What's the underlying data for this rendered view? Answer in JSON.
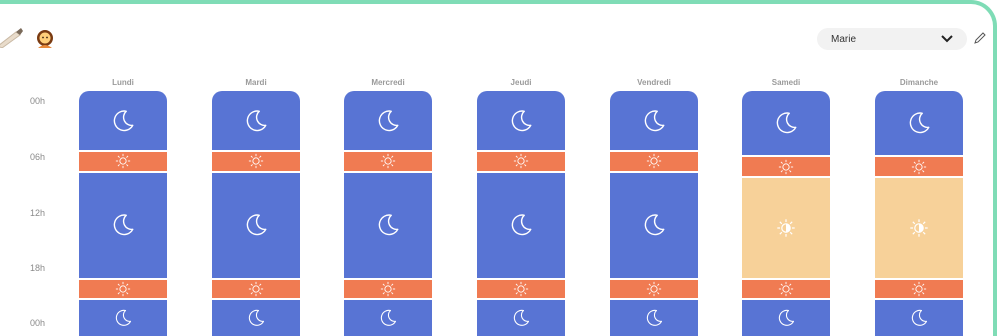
{
  "header": {
    "user_select_value": "Marie",
    "icons": {
      "brush": "brush-icon",
      "avatar": "person-avatar-icon",
      "dropdown": "chevron-down-icon",
      "edit": "pencil-icon"
    }
  },
  "hours": [
    "00h",
    "06h",
    "12h",
    "18h",
    "00h"
  ],
  "colors": {
    "night": "#5874d4",
    "day": "#f07b52",
    "light": "#f7d199",
    "accent": "#7fdcb6"
  },
  "days": [
    {
      "name": "Lundi",
      "segments": [
        {
          "type": "night",
          "from": 0,
          "to": 6
        },
        {
          "type": "day",
          "from": 6,
          "to": 8
        },
        {
          "type": "night",
          "from": 8,
          "to": 18.5
        },
        {
          "type": "day",
          "from": 18.5,
          "to": 20.5
        },
        {
          "type": "night",
          "from": 20.5,
          "to": 24
        }
      ]
    },
    {
      "name": "Mardi",
      "segments": [
        {
          "type": "night",
          "from": 0,
          "to": 6
        },
        {
          "type": "day",
          "from": 6,
          "to": 8
        },
        {
          "type": "night",
          "from": 8,
          "to": 18.5
        },
        {
          "type": "day",
          "from": 18.5,
          "to": 20.5
        },
        {
          "type": "night",
          "from": 20.5,
          "to": 24
        }
      ]
    },
    {
      "name": "Mercredi",
      "segments": [
        {
          "type": "night",
          "from": 0,
          "to": 6
        },
        {
          "type": "day",
          "from": 6,
          "to": 8
        },
        {
          "type": "night",
          "from": 8,
          "to": 18.5
        },
        {
          "type": "day",
          "from": 18.5,
          "to": 20.5
        },
        {
          "type": "night",
          "from": 20.5,
          "to": 24
        }
      ]
    },
    {
      "name": "Jeudi",
      "segments": [
        {
          "type": "night",
          "from": 0,
          "to": 6
        },
        {
          "type": "day",
          "from": 6,
          "to": 8
        },
        {
          "type": "night",
          "from": 8,
          "to": 18.5
        },
        {
          "type": "day",
          "from": 18.5,
          "to": 20.5
        },
        {
          "type": "night",
          "from": 20.5,
          "to": 24
        }
      ]
    },
    {
      "name": "Vendredi",
      "segments": [
        {
          "type": "night",
          "from": 0,
          "to": 6
        },
        {
          "type": "day",
          "from": 6,
          "to": 8
        },
        {
          "type": "night",
          "from": 8,
          "to": 18.5
        },
        {
          "type": "day",
          "from": 18.5,
          "to": 20.5
        },
        {
          "type": "night",
          "from": 20.5,
          "to": 24
        }
      ]
    },
    {
      "name": "Samedi",
      "segments": [
        {
          "type": "night",
          "from": 0,
          "to": 6.5
        },
        {
          "type": "day",
          "from": 6.5,
          "to": 8.5
        },
        {
          "type": "light",
          "from": 8.5,
          "to": 18.5
        },
        {
          "type": "day",
          "from": 18.5,
          "to": 20.5
        },
        {
          "type": "night",
          "from": 20.5,
          "to": 24
        }
      ]
    },
    {
      "name": "Dimanche",
      "segments": [
        {
          "type": "night",
          "from": 0,
          "to": 6.5
        },
        {
          "type": "day",
          "from": 6.5,
          "to": 8.5
        },
        {
          "type": "light",
          "from": 8.5,
          "to": 18.5
        },
        {
          "type": "day",
          "from": 18.5,
          "to": 20.5
        },
        {
          "type": "night",
          "from": 20.5,
          "to": 24
        }
      ]
    }
  ]
}
